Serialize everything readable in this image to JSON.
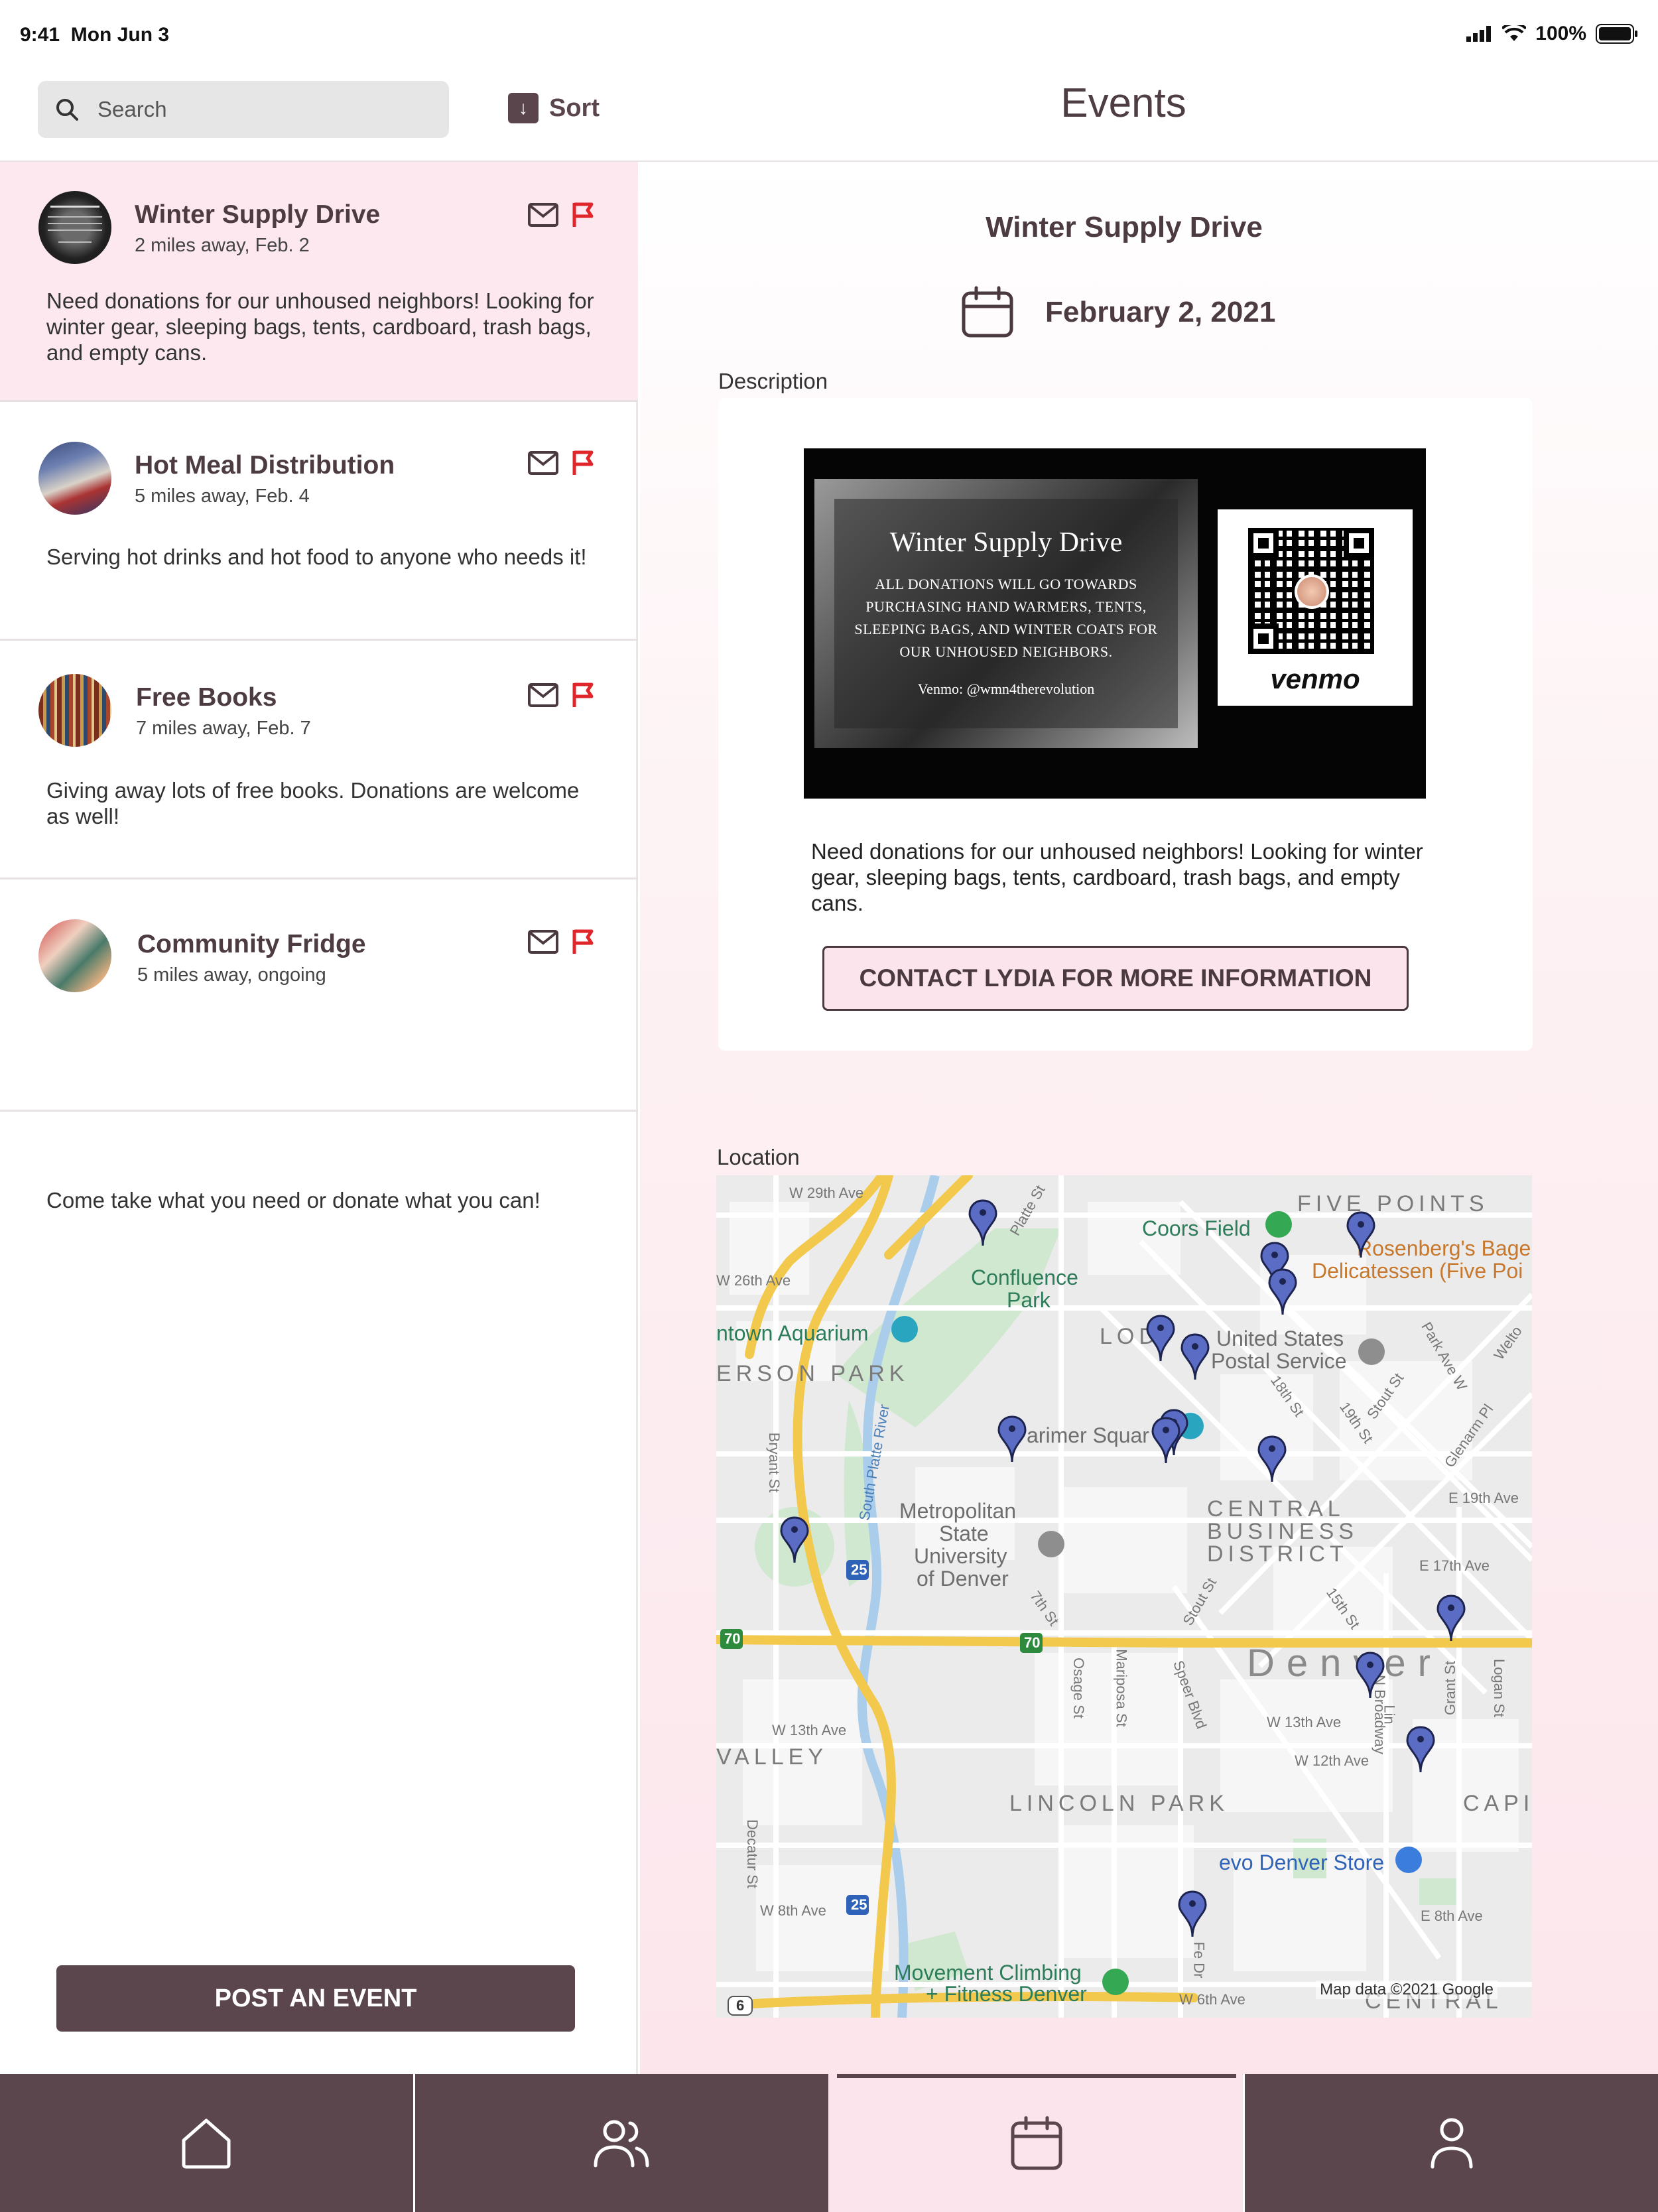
{
  "status_bar": {
    "time": "9:41",
    "date": "Mon Jun 3",
    "battery": "100%"
  },
  "header": {
    "search_placeholder": "Search",
    "sort_label": "Sort",
    "sort_icon": "arrow-down-icon",
    "title": "Events"
  },
  "events": [
    {
      "title": "Winter Supply Drive",
      "meta": "2 miles away, Feb. 2",
      "description": "Need donations for our unhoused neighbors! Looking for winter gear, sleeping bags, tents, cardboard, trash bags, and empty cans.",
      "selected": true
    },
    {
      "title": "Hot Meal Distribution",
      "meta": "5 miles away, Feb. 4",
      "description": "Serving hot drinks and hot food to anyone who needs it!",
      "selected": false
    },
    {
      "title": "Free Books",
      "meta": "7 miles away, Feb. 7",
      "description": "Giving away lots of free books. Donations are welcome as well!",
      "selected": false
    },
    {
      "title": "Community Fridge",
      "meta": "5 miles away, ongoing",
      "description": "Come take what you need or donate what you can!",
      "selected": false
    }
  ],
  "post_button": "POST AN EVENT",
  "detail": {
    "title": "Winter Supply Drive",
    "date": "February 2, 2021",
    "description_label": "Description",
    "poster": {
      "title": "Winter Supply Drive",
      "text": "ALL DONATIONS WILL GO TOWARDS PURCHASING HAND WARMERS, TENTS, SLEEPING BAGS, AND WINTER COATS FOR OUR UNHOUSED NEIGHBORS.",
      "venmo_handle": "Venmo: @wmn4therevolution",
      "venmo_logo": "venmo"
    },
    "description": "Need donations for our unhoused neighbors! Looking for winter gear, sleeping bags, tents, cardboard, trash bags, and empty cans.",
    "contact_button": "CONTACT LYDIA FOR MORE INFORMATION",
    "location_label": "Location"
  },
  "map": {
    "labels": {
      "five_points": "FIVE POINTS",
      "coors_field": "Coors Field",
      "rosenbergs": "Rosenberg's Bagels",
      "rosenbergs2": "Delicatessen (Five Poi",
      "confluence": "Confluence",
      "confluence2": "Park",
      "aquarium": "ntown Aquarium",
      "jefferson_park": "ERSON PARK",
      "lodo": "LOD",
      "usps": "United States",
      "usps2": "Postal Service",
      "larimer": "arimer Squar",
      "cbd1": "CENTRAL",
      "cbd2": "BUSINESS",
      "cbd3": "DISTRICT",
      "msu1": "Metropolitan",
      "msu2": "State",
      "msu3": "University",
      "msu4": "of Denver",
      "denver": "Denver",
      "valley": "VALLEY",
      "lincoln_park": "LINCOLN PARK",
      "capitol": "CAPIT",
      "evo": "evo Denver Store",
      "movement": "Movement Climbing",
      "movement2": "+ Fitness Denver",
      "central": "CENTRAL",
      "w29": "W 29th Ave",
      "w26": "W 26th Ave",
      "w13": "W 13th Ave",
      "w13b": "W 13th Ave",
      "w12": "W 12th Ave",
      "w8": "W 8th Ave",
      "w6": "W 6th Ave",
      "e19": "E 19th Ave",
      "e17": "E 17th Ave",
      "e8": "E 8th Ave",
      "platte_st": "Platte St",
      "bryant": "Bryant St",
      "south_platte": "South Platte River",
      "osage": "Osage St",
      "mariposa": "Mariposa St",
      "speer": "Speer Blvd",
      "decatur": "Decatur St",
      "broadway": "N Broadway",
      "grant": "Grant St",
      "logan": "Logan St",
      "park_ave": "Park Ave W",
      "stout": "Stout St",
      "st19": "19th St",
      "st18": "18th St",
      "st15": "15th St",
      "st7": "7th St",
      "glenarm": "Glenarm Pl",
      "welton": "Welto",
      "lincoln": "Lin",
      "fe_dr": "Fe Dr",
      "i25": "25",
      "i70": "70",
      "us6": "6"
    },
    "credit": "Map data ©2021 Google"
  },
  "tabs": [
    {
      "name": "home",
      "icon": "home-icon"
    },
    {
      "name": "community",
      "icon": "people-icon"
    },
    {
      "name": "events",
      "icon": "calendar-icon",
      "active": true
    },
    {
      "name": "profile",
      "icon": "person-icon"
    }
  ]
}
